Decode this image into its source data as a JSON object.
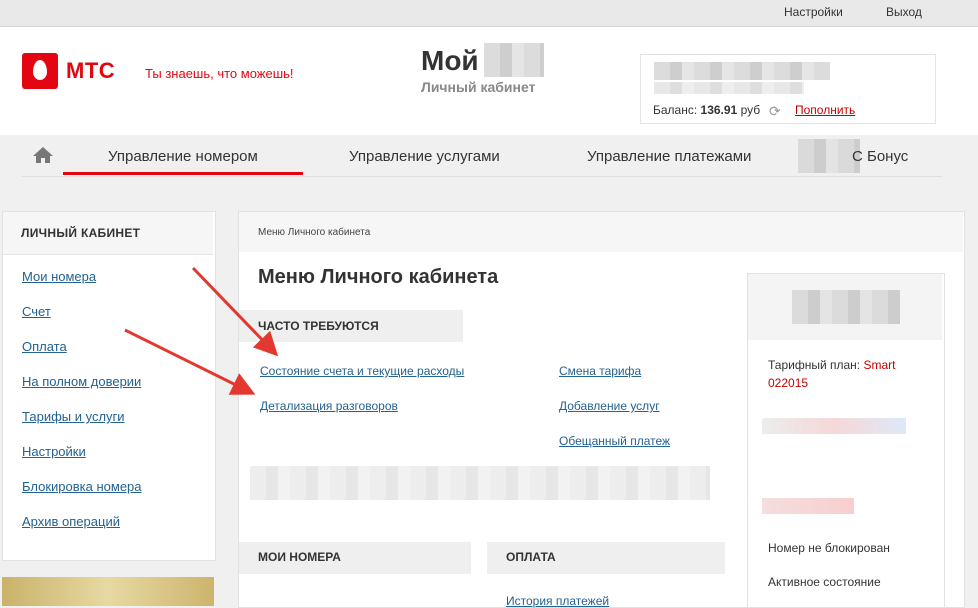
{
  "topbar": {
    "settings": "Настройки",
    "logout": "Выход"
  },
  "header": {
    "logo": "МТС",
    "slogan": "Ты знаешь, что можешь!",
    "title": "Мой",
    "subtitle": "Личный кабинет",
    "balance_label": "Баланс:",
    "balance_value": "136.91",
    "balance_currency": "руб",
    "topup": "Пополнить"
  },
  "nav": {
    "items": [
      {
        "label": "Управление номером",
        "active": true
      },
      {
        "label": "Управление услугами",
        "active": false
      },
      {
        "label": "Управление платежами",
        "active": false
      },
      {
        "label": "С Бонус",
        "active": false
      }
    ]
  },
  "sidebar": {
    "heading": "ЛИЧНЫЙ КАБИНЕТ",
    "items": [
      {
        "label": "Мои номера"
      },
      {
        "label": "Счет"
      },
      {
        "label": "Оплата"
      },
      {
        "label": "На полном доверии"
      },
      {
        "label": "Тарифы и услуги"
      },
      {
        "label": "Настройки"
      },
      {
        "label": "Блокировка номера"
      },
      {
        "label": "Архив операций"
      }
    ]
  },
  "main": {
    "breadcrumb": "Меню Личного кабинета",
    "title": "Меню Личного кабинета",
    "frequent_heading": "ЧАСТО ТРЕБУЮТСЯ",
    "frequent_left": [
      "Состояние счета и текущие расходы",
      "Детализация разговоров"
    ],
    "frequent_right": [
      "Смена тарифа",
      "Добавление услуг",
      "Обещанный платеж"
    ],
    "section_numbers": "МОИ НОМЕРА",
    "section_payment": "ОПЛАТА",
    "payment_history": "История платежей"
  },
  "right_card": {
    "tariff_label": "Тарифный план:",
    "tariff_name": "Smart",
    "tariff_code": "022015",
    "status_block": "Номер не блокирован",
    "status_active": "Активное состояние"
  },
  "colors": {
    "brand": "#e30611",
    "link": "#24628f",
    "arrow": "#e2382f"
  }
}
